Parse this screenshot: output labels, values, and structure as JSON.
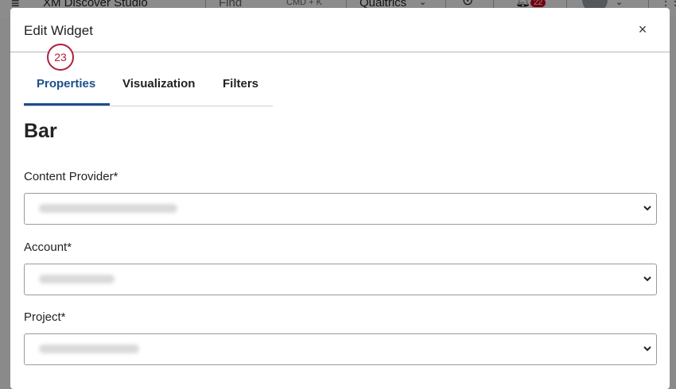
{
  "app": {
    "menu_icon": "hamburger-icon",
    "title": "XM Discover Studio",
    "find_label": "Find",
    "find_shortcut": "CMD + K",
    "org_name": "Qualtrics",
    "notification_count": "22"
  },
  "modal": {
    "title": "Edit Widget",
    "close_icon": "close-icon",
    "step_badge": "23",
    "tabs": [
      {
        "label": "Properties",
        "active": true
      },
      {
        "label": "Visualization",
        "active": false
      },
      {
        "label": "Filters",
        "active": false
      }
    ],
    "section_title": "Bar",
    "fields": [
      {
        "label": "Content Provider*",
        "value": "content-provider"
      },
      {
        "label": "Account*",
        "value": "account-name"
      },
      {
        "label": "Project*",
        "value": "project-name"
      }
    ]
  },
  "colors": {
    "accent": "#1b4f8a",
    "badge": "#b01e3a",
    "notification": "#d0021b"
  }
}
